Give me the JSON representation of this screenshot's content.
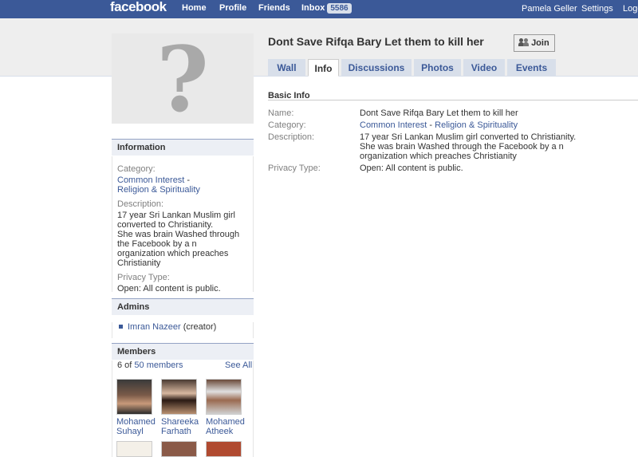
{
  "topbar": {
    "logo": "facebook",
    "nav": [
      "Home",
      "Profile",
      "Friends"
    ],
    "inbox_label": "Inbox",
    "inbox_count": "5586",
    "user": "Pamela Geller",
    "settings": "Settings",
    "logout": "Logo"
  },
  "group": {
    "title": "Dont Save Rifqa Bary Let them to kill her",
    "join_label": "Join"
  },
  "tabs": [
    "Wall",
    "Info",
    "Discussions",
    "Photos",
    "Video",
    "Events"
  ],
  "sidebar": {
    "information": {
      "heading": "Information",
      "category_label": "Category:",
      "category_1": "Common Interest",
      "category_sep": " - ",
      "category_2": "Religion & Spirituality",
      "description_label": "Description:",
      "description_1": "17 year Sri Lankan Muslim girl converted to Christianity.",
      "description_2": "She was brain Washed through the Facebook by a n organization which preaches Christianity",
      "privacy_label": "Privacy Type:",
      "privacy_value": "Open: All content is public."
    },
    "admins": {
      "heading": "Admins",
      "admin_name": "Imran Nazeer",
      "admin_role": "(creator)"
    },
    "members": {
      "heading": "Members",
      "count_prefix": "6 of",
      "count_link": "50 members",
      "see_all": "See All",
      "list": [
        {
          "line1": "Mohamed",
          "line2": "Suhayl"
        },
        {
          "line1": "Shareeka",
          "line2": "Farhath"
        },
        {
          "line1": "Mohamed",
          "line2": "Atheek"
        }
      ]
    }
  },
  "basic_info": {
    "heading": "Basic Info",
    "name_label": "Name:",
    "name_value": "Dont Save Rifqa Bary Let them to kill her",
    "category_label": "Category:",
    "category_1": "Common Interest",
    "category_sep": " - ",
    "category_2": "Religion & Spirituality",
    "description_label": "Description:",
    "description_1": "17 year Sri Lankan Muslim girl converted to Christianity.",
    "description_2": "She was brain Washed through the Facebook by a n organization which preaches Christianity",
    "privacy_label": "Privacy Type:",
    "privacy_value": "Open: All content is public."
  },
  "colors": {
    "brand_blue": "#3b5998",
    "tab_bg": "#d8dfea",
    "box_head_bg": "#eceff5"
  }
}
